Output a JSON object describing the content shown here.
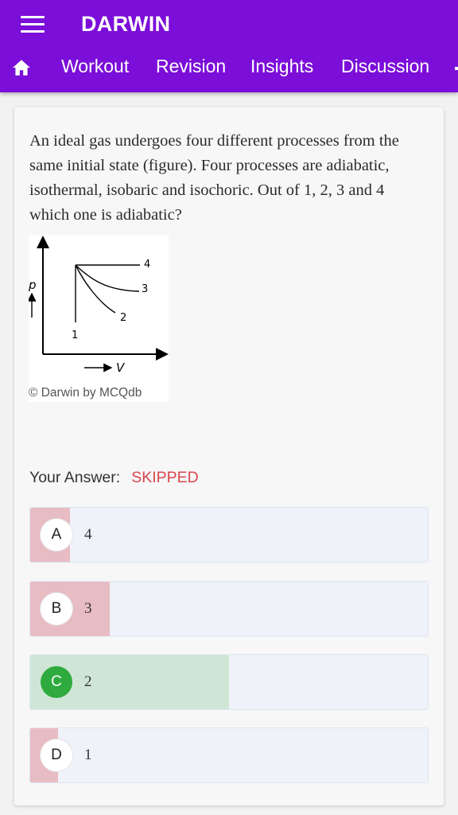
{
  "header": {
    "title": "DARWIN",
    "nav_tabs": [
      "Workout",
      "Revision",
      "Insights",
      "Discussion"
    ]
  },
  "question": {
    "text": "An ideal gas undergoes four different processes from the same initial state (figure). Four processes are adiabatic, isothermal, isobaric and isochoric. Out of 1, 2, 3 and 4 which one is adiabatic?"
  },
  "figure": {
    "axis_p": "p",
    "axis_v": "V",
    "curve_labels": [
      "1",
      "2",
      "3",
      "4"
    ],
    "caption": "© Darwin by MCQdb"
  },
  "answer": {
    "label": "Your Answer:",
    "status": "SKIPPED"
  },
  "options": [
    {
      "letter": "A",
      "text": "4",
      "fill_fraction": 0.1,
      "fill_color": "#e8bcc3",
      "correct": false
    },
    {
      "letter": "B",
      "text": "3",
      "fill_fraction": 0.2,
      "fill_color": "#e8bcc3",
      "correct": false
    },
    {
      "letter": "C",
      "text": "2",
      "fill_fraction": 0.5,
      "fill_color": "#cfe6d6",
      "correct": true
    },
    {
      "letter": "D",
      "text": "1",
      "fill_fraction": 0.07,
      "fill_color": "#e8bcc3",
      "correct": false
    }
  ],
  "colors": {
    "header_bg": "#7b0ed8",
    "skipped": "#d9474f",
    "correct_circle": "#2eaa3e"
  },
  "icons": [
    "menu-icon",
    "home-icon"
  ]
}
